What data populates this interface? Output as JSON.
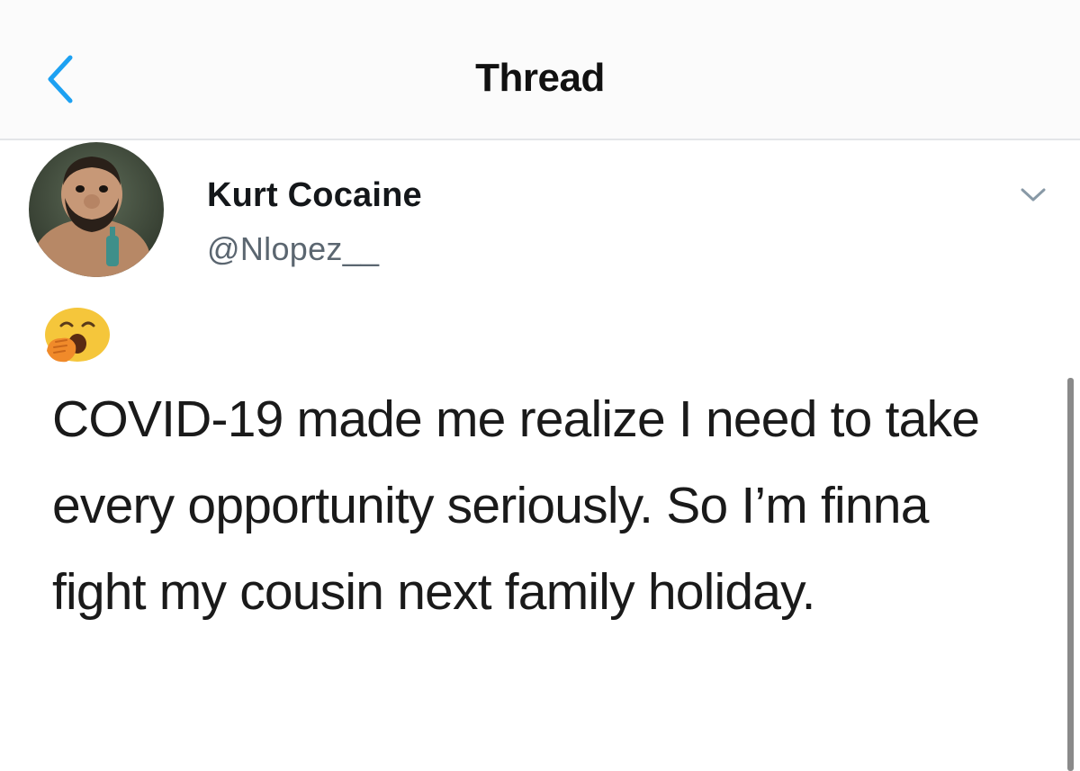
{
  "header": {
    "title": "Thread",
    "back_icon": "chevron-left-icon",
    "accent_color": "#1da1f2"
  },
  "tweet": {
    "display_name": "Kurt Cocaine",
    "handle": "@Nlopez__",
    "emoji": "yawning-face",
    "text": "COVID-19 made me realize I need to take every opportunity seriously. So I’m finna fight my cousin next family holiday.",
    "more_icon": "chevron-down-icon"
  }
}
